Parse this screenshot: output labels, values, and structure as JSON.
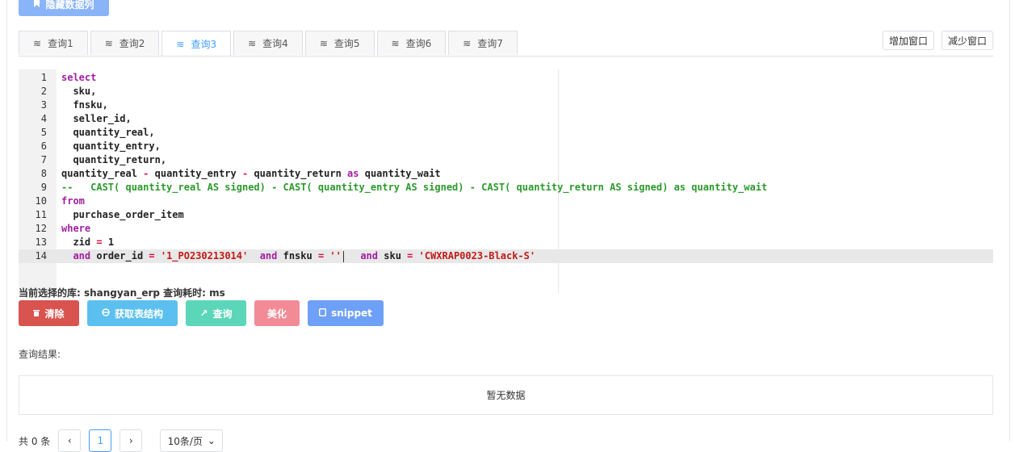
{
  "top_button": {
    "label": "隐藏数据列",
    "icon": "bookmark-icon"
  },
  "tabs": [
    {
      "label": "查询1",
      "active": false
    },
    {
      "label": "查询2",
      "active": false
    },
    {
      "label": "查询3",
      "active": true
    },
    {
      "label": "查询4",
      "active": false
    },
    {
      "label": "查询5",
      "active": false
    },
    {
      "label": "查询6",
      "active": false
    },
    {
      "label": "查询7",
      "active": false
    }
  ],
  "window_buttons": {
    "add": "增加窗口",
    "remove": "减少窗口"
  },
  "editor": {
    "current_line": 14,
    "lines": [
      "select",
      "  sku,",
      "  fnsku,",
      "  seller_id,",
      "  quantity_real,",
      "  quantity_entry,",
      "  quantity_return,",
      "quantity_real - quantity_entry - quantity_return as quantity_wait",
      "--   CAST( quantity_real AS signed) - CAST( quantity_entry AS signed) - CAST( quantity_return AS signed) as quantity_wait",
      "from",
      "  purchase_order_item",
      "where",
      "  zid = 1",
      "  and order_id = '1_PO230213014'  and fnsku = ''  and sku = 'CWXRAP0023-Black-S'"
    ]
  },
  "status": {
    "text": "当前选择的库: shangyan_erp   查询耗时: ms"
  },
  "actions": [
    {
      "label": "清除",
      "icon": "trash-icon",
      "color": "#d9534f"
    },
    {
      "label": "获取表结构",
      "icon": "database-icon",
      "color": "#5bc0f0"
    },
    {
      "label": "查询",
      "icon": "share-arrow-icon",
      "color": "#5cd6b8"
    },
    {
      "label": "美化",
      "icon": "",
      "color": "#f28b96"
    },
    {
      "label": "snippet",
      "icon": "copy-icon",
      "color": "#6fa0f7"
    }
  ],
  "result": {
    "label": "查询结果:",
    "empty_text": "暂无数据"
  },
  "pagination": {
    "total": "共 0 条",
    "current_page": "1",
    "page_size": "10条/页"
  }
}
